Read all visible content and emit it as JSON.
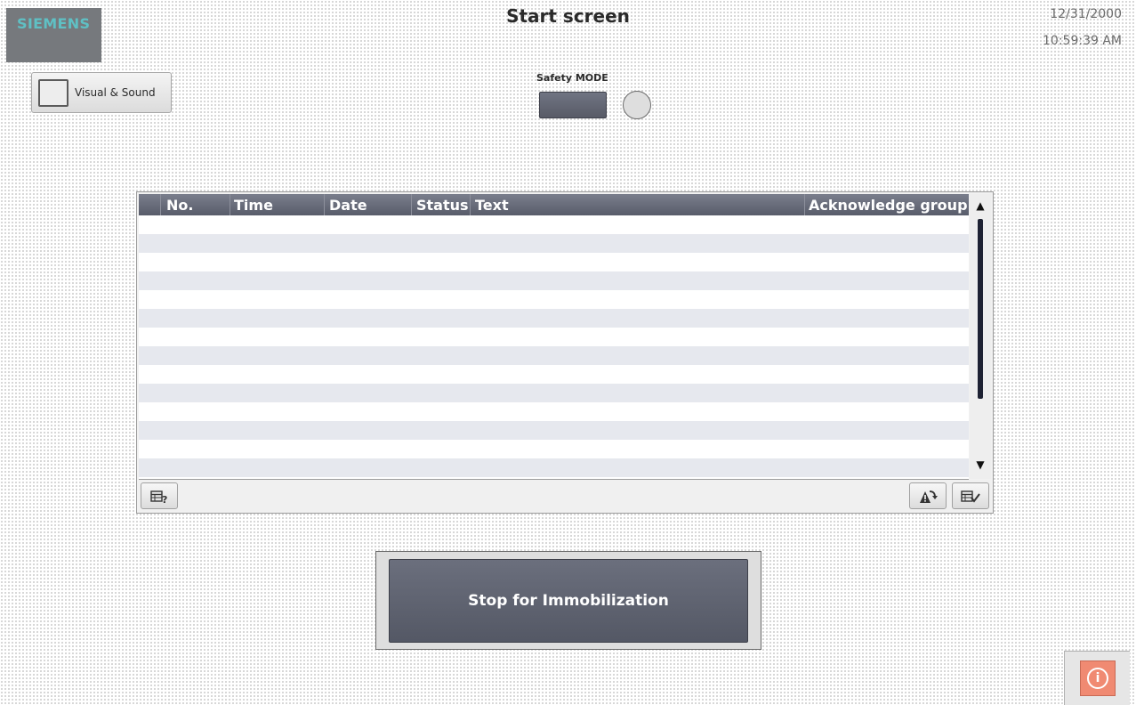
{
  "header": {
    "logo_text": "SIEMENS",
    "title": "Start screen",
    "date": "12/31/2000",
    "time": "10:59:39 AM"
  },
  "visual_sound": {
    "label": "Visual & Sound"
  },
  "safety": {
    "label": "Safety MODE",
    "lamp_state": "off"
  },
  "alarm_view": {
    "columns": [
      "No.",
      "Time",
      "Date",
      "Status",
      "Text",
      "Acknowledge group"
    ],
    "rows": [],
    "scroll_up_glyph": "▲",
    "scroll_down_glyph": "▼",
    "toolbar_icons": [
      "alarm-help-icon",
      "alarm-loop-in-icon",
      "alarm-acknowledge-icon"
    ]
  },
  "stop_button": {
    "label": "Stop for Immobilization"
  },
  "info_button": {
    "icon": "info-icon",
    "glyph": "i"
  },
  "colors": {
    "header_bar": "#5c6070",
    "button_dark": "#5c606d",
    "info_button": "#f08a72",
    "logo_bg": "#76797d",
    "logo_text": "#5fc0c4"
  }
}
